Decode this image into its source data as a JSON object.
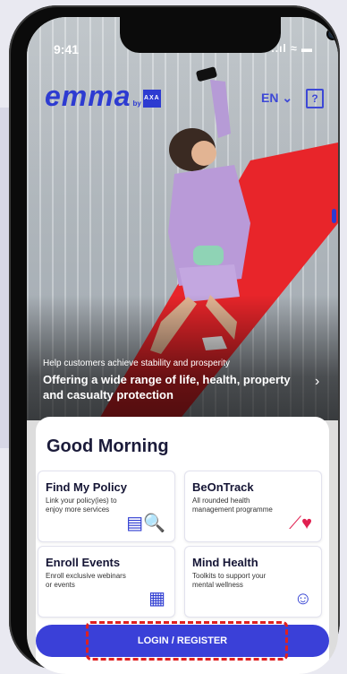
{
  "status": {
    "time": "9:41",
    "signal": "..ıl ≈ ▬"
  },
  "header": {
    "brand": "emma",
    "by": "by",
    "brand_tag": "AXA",
    "language": "EN ⌄",
    "help_icon": "?"
  },
  "hero": {
    "subtitle": "Help customers achieve stability and prosperity",
    "title": "Offering a wide range of life, health, property and casualty protection",
    "chevron": "›"
  },
  "greeting": "Good Morning",
  "cards": [
    {
      "title": "Find My Policy",
      "desc": "Link your policy(ies) to enjoy more services",
      "icon": "policy-search-icon",
      "glyph": "▤🔍"
    },
    {
      "title": "BeOnTrack",
      "desc": "All rounded health management programme",
      "icon": "track-heart-icon",
      "glyph": "⟋♥"
    },
    {
      "title": "Enroll Events",
      "desc": "Enroll exclusive webinars or events",
      "icon": "calendar-icon",
      "glyph": "▦"
    },
    {
      "title": "Mind Health",
      "desc": "Toolkits to support your mental wellness",
      "icon": "mind-chat-icon",
      "glyph": "☺"
    }
  ],
  "login_label": "LOGIN / REGISTER",
  "colors": {
    "brand": "#2d3bd1",
    "accent_red": "#e02020"
  }
}
